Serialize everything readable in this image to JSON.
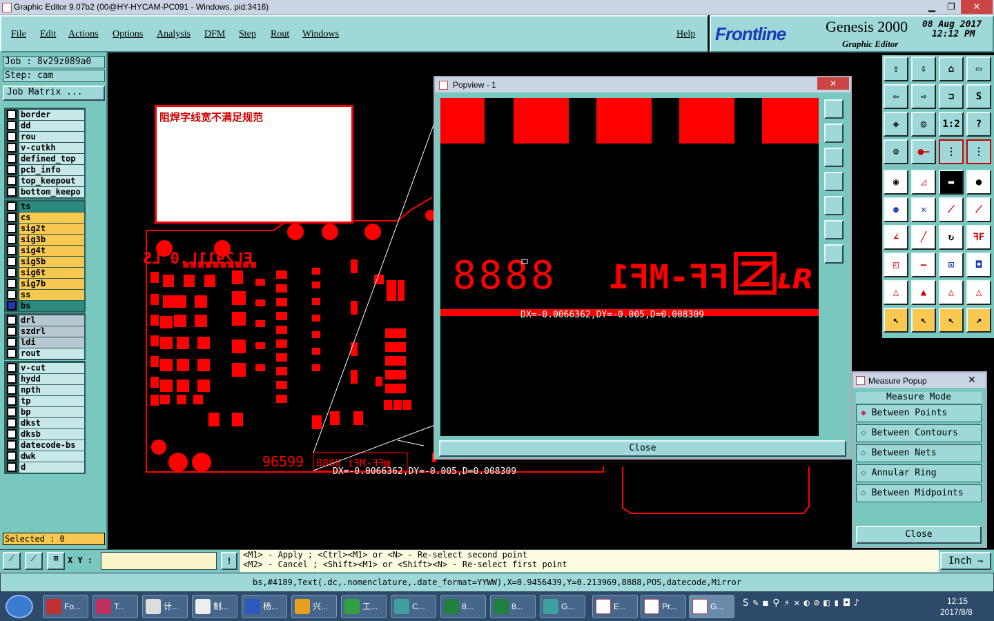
{
  "window": {
    "title": "Graphic Editor 9.07b2 (00@HY-HYCAM-PC091 - Windows, pid:3416)"
  },
  "menu": {
    "items": [
      "File",
      "Edit",
      "Actions",
      "Options",
      "Analysis",
      "DFM",
      "Step",
      "Rout",
      "Windows"
    ],
    "help": "Help"
  },
  "logo": {
    "brand": "Frontline",
    "product": "Genesis 2000",
    "subtitle": "Graphic Editor",
    "date": "08 Aug 2017",
    "time": "12:12 PM"
  },
  "job": {
    "job_label": "Job : 8v29z089a0",
    "step_label": "Step: cam",
    "matrix_button": "Job Matrix ..."
  },
  "layers": {
    "group1": [
      "border",
      "dd",
      "rou",
      "v-cutkh",
      "defined_top",
      "pcb_info",
      "top_keepout",
      "bottom_keepo"
    ],
    "group2": [
      "ts",
      "cs",
      "sig2t",
      "sig3b",
      "sig4t",
      "sig5b",
      "sig6t",
      "sig7b",
      "ss",
      "bs"
    ],
    "group3": [
      "drl",
      "szdrl",
      "ldi",
      "rout"
    ],
    "group4": [
      "v-cut",
      "hydd",
      "npth",
      "tp",
      "bp",
      "dkst",
      "dksb",
      "datecode-bs",
      "dwk",
      "d"
    ]
  },
  "selected": "Selected : 0",
  "note": {
    "text": "阻焊字线宽不满足规范"
  },
  "board": {
    "text_top": "EL2911L.0 LS",
    "text_bottom": "96599",
    "measure": "DX=-0.0066362,DY=-0.005,D=0.008309"
  },
  "popview": {
    "title": "Popview - 1",
    "text_digits": "8888",
    "text_code": "FF-MF1",
    "measure": "DX=-0.0066362,DY=-0.005,D=0.008309",
    "close": "Close"
  },
  "measure_popup": {
    "title": "Measure Popup",
    "mode_label": "Measure Mode",
    "options": [
      "Between Points",
      "Between Contours",
      "Between Nets",
      "Annular Ring",
      "Between Midpoints"
    ],
    "close": "Close"
  },
  "bottom": {
    "xy_label": "X Y :",
    "hint1": "<M1> - Apply  ; <Ctrl><M1> or <N> - Re-select second point",
    "hint2": "<M2> - Cancel ; <Shift><M1> or <Shift><N> - Re-select first point",
    "units": "Inch"
  },
  "status": {
    "text": "bs,#4189,Text(.dc,.nomenclature,.date_format=YYWW),X=0.9456439,Y=0.213969,8888,POS,datecode,Mirror"
  },
  "taskbar": {
    "items": [
      "Fo...",
      "T...",
      "计...",
      "制...",
      "杨...",
      "兴...",
      "工...",
      "C...",
      "8...",
      "8...",
      "G...",
      "E...",
      "Pr...",
      "G..."
    ],
    "time": "12:15",
    "date": "2017/8/8"
  },
  "colors": {
    "layer_teal": "#2a8a80",
    "layer_yellow": "#f8c850",
    "layer_gray": "#b8c8d0",
    "layer_white": "#c8e8e8",
    "pcb_red": "#ff0000"
  }
}
